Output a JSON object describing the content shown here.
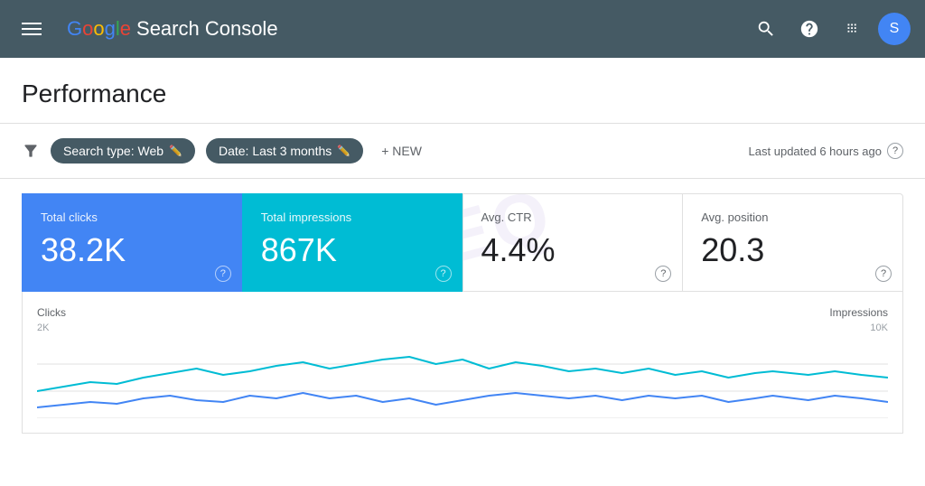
{
  "header": {
    "title": "Google Search Console",
    "logo_google": "Google",
    "logo_product": "Search Console",
    "avatar_letter": "S"
  },
  "filters": {
    "search_type_label": "Search type: Web",
    "date_label": "Date: Last 3 months",
    "new_button": "+ NEW",
    "last_updated": "Last updated 6 hours ago"
  },
  "metrics": [
    {
      "label": "Total clicks",
      "value": "38.2K",
      "type": "active-blue"
    },
    {
      "label": "Total impressions",
      "value": "867K",
      "type": "active-teal"
    },
    {
      "label": "Avg. CTR",
      "value": "4.4%",
      "type": "normal"
    },
    {
      "label": "Avg. position",
      "value": "20.3",
      "type": "normal"
    }
  ],
  "chart": {
    "left_label": "Clicks",
    "right_label": "Impressions",
    "left_scale": "2K",
    "right_scale": "10K"
  },
  "page_title": "Performance"
}
